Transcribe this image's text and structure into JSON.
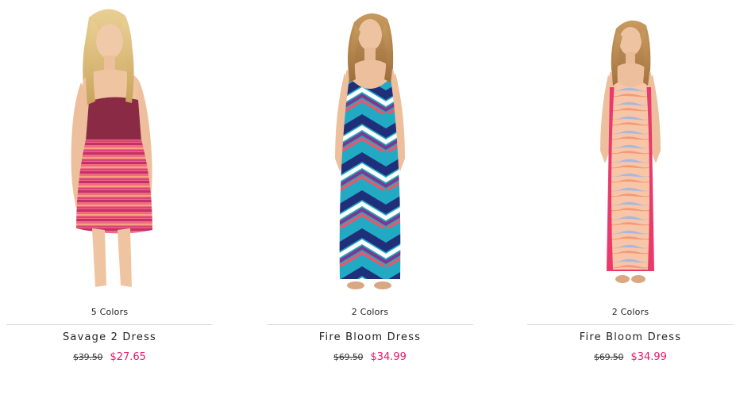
{
  "products": [
    {
      "colors_text": "5 Colors",
      "name": "Savage 2 Dress",
      "old_price": "$39.50",
      "sale_price": "$27.65"
    },
    {
      "colors_text": "2 Colors",
      "name": "Fire Bloom Dress",
      "old_price": "$69.50",
      "sale_price": "$34.99"
    },
    {
      "colors_text": "2 Colors",
      "name": "Fire Bloom Dress",
      "old_price": "$69.50",
      "sale_price": "$34.99"
    }
  ],
  "accent_color": "#e8196d"
}
